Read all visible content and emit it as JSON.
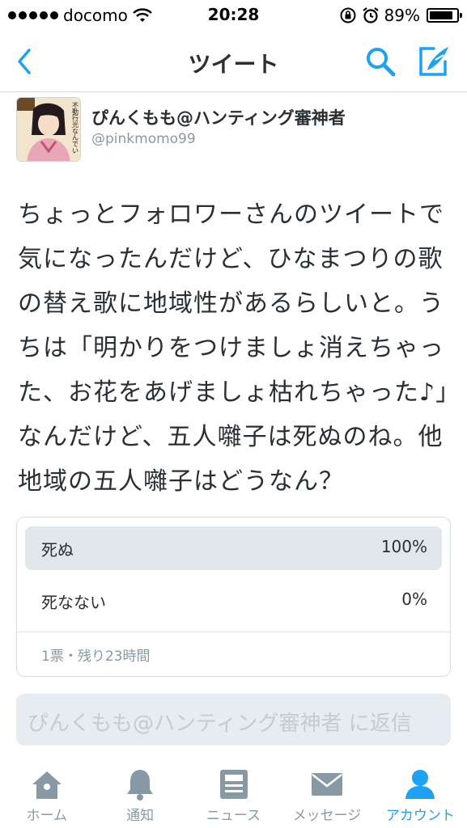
{
  "status_bar": {
    "carrier": "docomo",
    "time": "20:28",
    "battery_percent": "89%",
    "battery_level": 0.89
  },
  "nav": {
    "title": "ツイート",
    "back_icon": "chevron-left-icon",
    "search_icon": "search-icon",
    "compose_icon": "compose-icon"
  },
  "tweet": {
    "display_name": "ぴんくもも@ハンティング審神者",
    "handle": "@pinkmomo99",
    "avatar_text": "不動行光なんでい",
    "text": "ちょっとフォロワーさんのツイートで気になったんだけど、ひなまつりの歌の替え歌に地域性があるらしいと。うちは「明かりをつけましょ消えちゃった、お花をあげましょ枯れちゃった♪」なんだけど、五人囃子は死ぬのね。他地域の五人囃子はどうなん？"
  },
  "poll": {
    "options": [
      {
        "label": "死ぬ",
        "percent_text": "100%",
        "fraction": 1.0
      },
      {
        "label": "死なない",
        "percent_text": "0%",
        "fraction": 0.0
      }
    ],
    "meta": "1票・残り23時間"
  },
  "reply": {
    "placeholder": "ぴんくもも@ハンティング審神者 に返信"
  },
  "tabs": [
    {
      "label": "ホーム",
      "icon": "home-icon"
    },
    {
      "label": "通知",
      "icon": "bell-icon"
    },
    {
      "label": "ニュース",
      "icon": "news-icon"
    },
    {
      "label": "メッセージ",
      "icon": "envelope-icon"
    },
    {
      "label": "アカウント",
      "icon": "person-icon",
      "active": true
    }
  ],
  "colors": {
    "accent": "#1da1f2",
    "icon_gray": "#8899a6",
    "poll_fill": "#e1e8ed"
  }
}
